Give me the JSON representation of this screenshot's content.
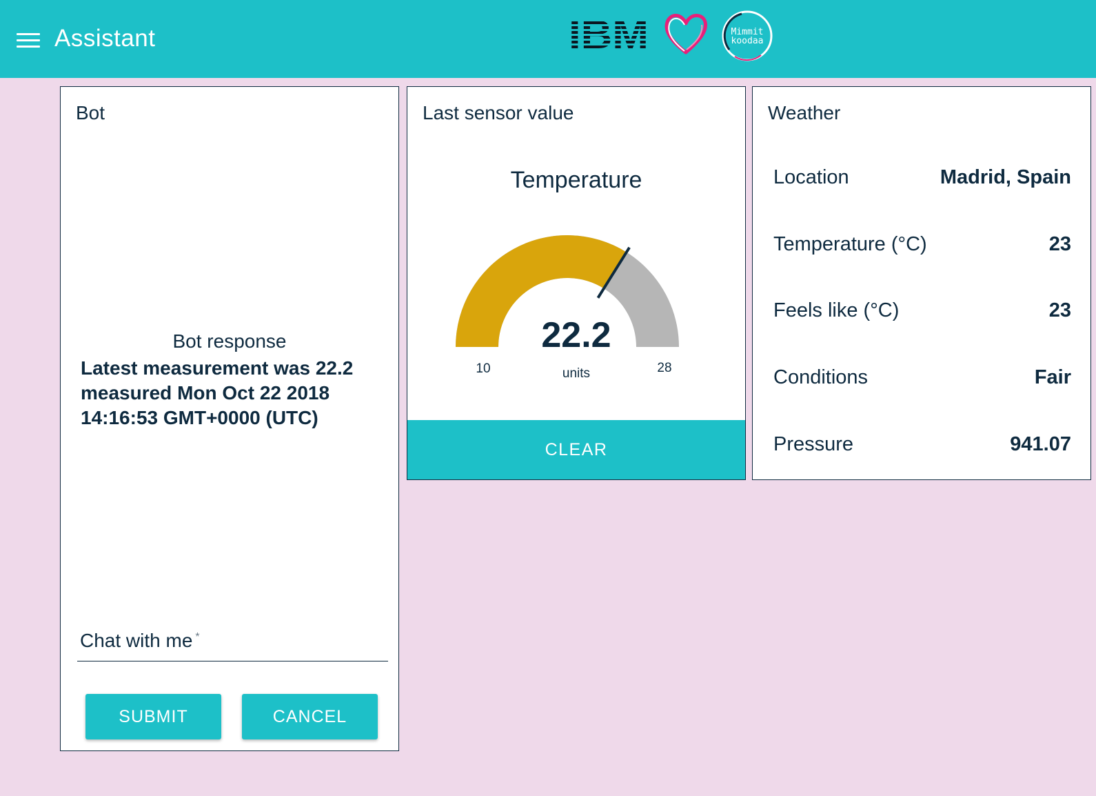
{
  "app": {
    "title": "Assistant"
  },
  "logos": {
    "ibm_text": "IBM",
    "mimmit_text_1": "Mimmit",
    "mimmit_text_2": "koodaa"
  },
  "bot": {
    "title": "Bot",
    "response_label": "Bot response",
    "response_text": "Latest measurement was 22.2 measured Mon Oct 22 2018 14:16:53 GMT+0000 (UTC)",
    "chat_label": "Chat with me",
    "chat_required_mark": "*",
    "chat_value": "",
    "submit_label": "SUBMIT",
    "cancel_label": "CANCEL"
  },
  "sensor": {
    "title": "Last sensor value",
    "gauge_title": "Temperature",
    "value": "22.2",
    "units": "units",
    "min": "10",
    "max": "28",
    "clear_label": "CLEAR",
    "colors": {
      "fill": "#d9a50c",
      "track": "#b6b6b6",
      "needle": "#0e2a3f"
    }
  },
  "weather": {
    "title": "Weather",
    "rows": [
      {
        "label": "Location",
        "value": "Madrid, Spain"
      },
      {
        "label": "Temperature (°C)",
        "value": "23"
      },
      {
        "label": "Feels like (°C)",
        "value": "23"
      },
      {
        "label": "Conditions",
        "value": "Fair"
      },
      {
        "label": "Pressure",
        "value": "941.07"
      }
    ]
  },
  "colors": {
    "topbar": "#1dc0c8",
    "background": "#efd9ea",
    "text": "#0e2a3f",
    "button": "#1dc0c8"
  }
}
